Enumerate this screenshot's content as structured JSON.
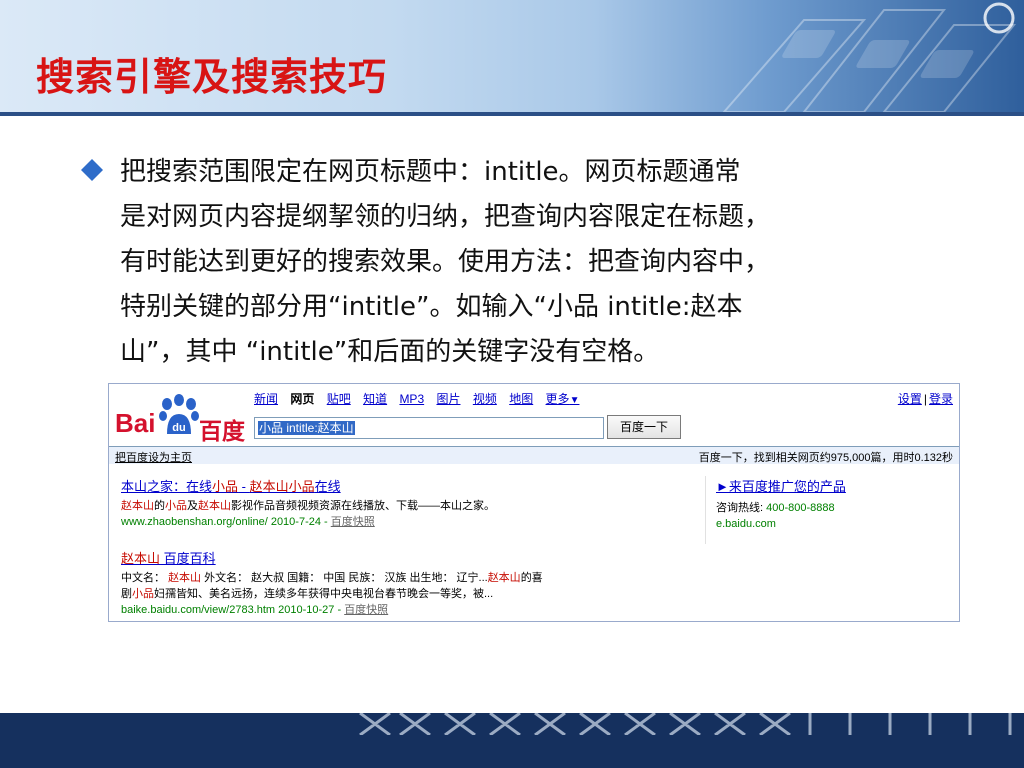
{
  "slide": {
    "title": "搜索引擎及搜索技巧",
    "bullet_lines": [
      "把搜索范围限定在网页标题中：intitle。网页标题通常",
      "是对网页内容提纲挈领的归纳，把查询内容限定在标题，",
      "有时能达到更好的搜索效果。使用方法：把查询内容中，",
      "特别关键的部分用“intitle”。如输入“小品 intitle:赵本",
      "山”，其中 “intitle”和后面的关键字没有空格。"
    ]
  },
  "colors": {
    "title_red": "#d81414",
    "baidu_red": "#d4112d",
    "baidu_blue": "#2a62c9",
    "link_blue": "#0000cc",
    "url_green": "#008000",
    "highlight_red": "#c60a00",
    "footer_navy": "#15305e"
  },
  "baidu": {
    "logo_bai": "Bai",
    "logo_du": "du",
    "logo_cn": "百度",
    "nav": {
      "news": "新闻",
      "web": "网页",
      "tieba": "贴吧",
      "zhidao": "知道",
      "mp3": "MP3",
      "images": "图片",
      "video": "视频",
      "map": "地图",
      "more": "更多",
      "more_arrow": "▼"
    },
    "settings": "设置",
    "separator": "|",
    "login": "登录",
    "search_value": "小品 intitle:赵本山",
    "search_button": "百度一下",
    "set_homepage": "把百度设为主页",
    "stats": "百度一下，找到相关网页约975,000篇，用时0.132秒",
    "results": [
      {
        "title_parts": [
          "本山之家：在线",
          "小品",
          " - ",
          "赵本山小品",
          "在线"
        ],
        "desc_parts": [
          "赵本山",
          "的",
          "小品",
          "及",
          "赵本山",
          "影视作品音频视频资源在线播放、下载——本山之家。"
        ],
        "url": "www.zhaobenshan.org/online/ 2010-7-24 - ",
        "cache": "百度快照"
      },
      {
        "title_parts": [
          "赵本山",
          " 百度百科"
        ],
        "desc1_parts": [
          "中文名： ",
          "赵本山",
          " 外文名： 赵大叔 国籍： 中国 民族： 汉族 出生地： 辽宁...",
          "赵本山",
          "的喜"
        ],
        "desc2_parts": [
          "剧",
          "小品",
          "妇孺皆知、美名远扬，连续多年获得中央电视台春节晚会一等奖，被..."
        ],
        "url": "baike.baidu.com/view/2783.htm 2010-10-27 - ",
        "cache": "百度快照"
      }
    ],
    "ad": {
      "title": "►来百度推广您的产品",
      "hotline_label": "咨询热线: ",
      "hotline": "400-800-8888",
      "site": "e.baidu.com"
    }
  }
}
